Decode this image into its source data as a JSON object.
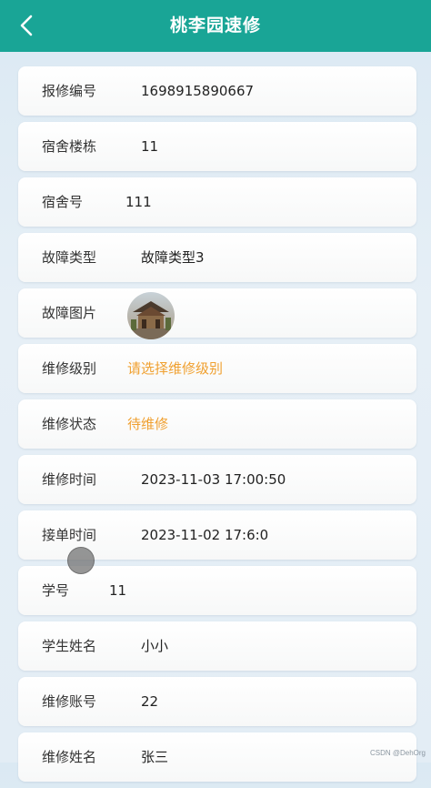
{
  "header": {
    "title": "桃李园速修",
    "back_icon": "chevron-left-icon",
    "background": "#19a596"
  },
  "fields": [
    {
      "label": "报修编号",
      "value": "1698915890667"
    },
    {
      "label": "宿舍楼栋",
      "value": "11"
    },
    {
      "label": "宿舍号",
      "value": "111"
    },
    {
      "label": "故障类型",
      "value": "故障类型3"
    },
    {
      "label": "故障图片",
      "value": ""
    },
    {
      "label": "维修级别",
      "value": "请选择维修级别"
    },
    {
      "label": "维修状态",
      "value": "待维修"
    },
    {
      "label": "维修时间",
      "value": "2023-11-03 17:00:50"
    },
    {
      "label": "接单时间",
      "value": "2023-11-02 17:6:0"
    },
    {
      "label": "学号",
      "value": "11"
    },
    {
      "label": "学生姓名",
      "value": "小小"
    },
    {
      "label": "维修账号",
      "value": "22"
    },
    {
      "label": "维修姓名",
      "value": "张三"
    }
  ],
  "colors": {
    "placeholder": "#f0a030",
    "label": "#333333"
  },
  "watermark": "CSDN @DehOrg"
}
